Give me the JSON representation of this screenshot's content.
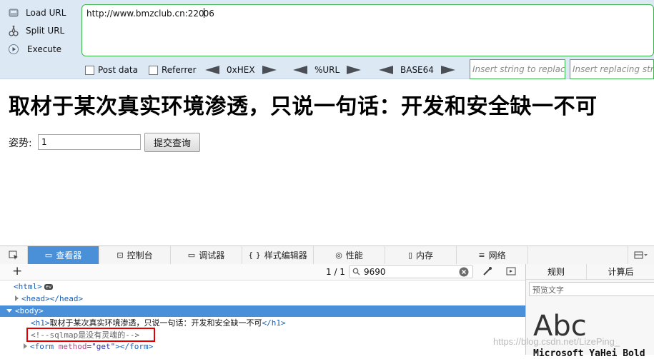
{
  "hackbar": {
    "load_url": "Load URL",
    "split_url": "Split URL",
    "execute": "Execute",
    "url_before_caret": "http://www.bmzclub.cn:220",
    "url_after_caret": "06",
    "post_data": "Post data",
    "referrer": "Referrer",
    "hex": "0xHEX",
    "url_enc": "%URL",
    "base64": "BASE64",
    "insert_string_placeholder": "Insert string to replace",
    "insert_replacing_placeholder": "Insert replacing string"
  },
  "page": {
    "heading": "取材于某次真实环境渗透，只说一句话：开发和安全缺一不可",
    "pose_label": "姿势:",
    "pose_value": "1",
    "submit": "提交查询"
  },
  "devtools": {
    "tabs": [
      {
        "label": "查看器",
        "icon": "inspector-icon"
      },
      {
        "label": "控制台",
        "icon": "console-icon"
      },
      {
        "label": "调试器",
        "icon": "debugger-icon"
      },
      {
        "label": "样式编辑器",
        "icon": "{ }"
      },
      {
        "label": "性能",
        "icon": "performance-icon"
      },
      {
        "label": "内存",
        "icon": "memory-icon"
      },
      {
        "label": "网络",
        "icon": "network-icon"
      }
    ],
    "match_count": "1 / 1",
    "search_value": "9690",
    "tree": {
      "html": "<html>",
      "ev": "ev",
      "head": "<head></head>",
      "body": "<body>",
      "h1_open": "<h1>",
      "h1_text": "取材于某次真实环境渗透，只说一句话：开发和安全缺一不可",
      "h1_close": "</h1>",
      "comment": "<!--sqlmap是没有灵魂的-->",
      "form_open": "<form",
      "form_attr": "method",
      "form_eq": "=",
      "form_val": "\"get\"",
      "form_close": "></form>"
    },
    "right_tabs": [
      "规则",
      "计算后"
    ],
    "preview_placeholder": "预览文字",
    "abc": "Abc",
    "font_name": "Microsoft YaHei Bold"
  },
  "watermark": "https://blog.csdn.net/LizePing_"
}
